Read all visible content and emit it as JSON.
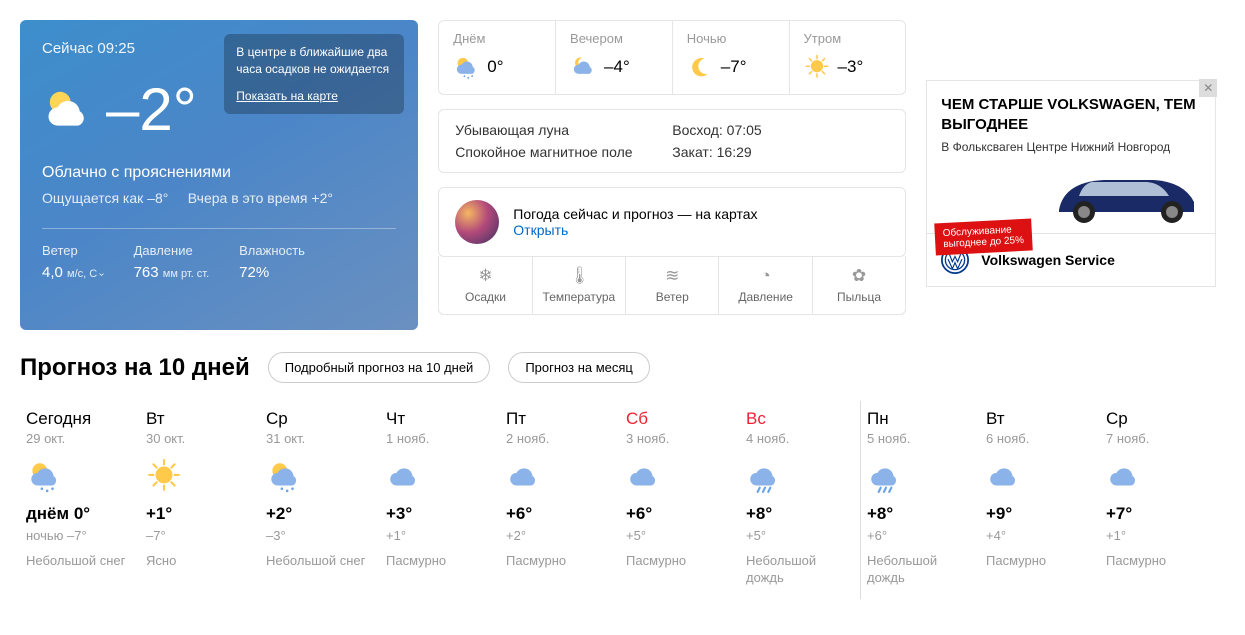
{
  "now": {
    "time_label": "Сейчас 09:25",
    "temp": "–2°",
    "condition": "Облачно с прояснениями",
    "feels_prefix": "Ощущается как ",
    "feels_temp": "–8°",
    "yesterday_prefix": "Вчера в это время ",
    "yesterday_temp": "+2°",
    "wind_label": "Ветер",
    "wind_value": "4,0",
    "wind_unit": "м/с, С",
    "pressure_label": "Давление",
    "pressure_value": "763",
    "pressure_unit": "мм рт. ст.",
    "humidity_label": "Влажность",
    "humidity_value": "72%",
    "bubble_text": "В центре в ближайшие два часа осадков не ожидается",
    "bubble_link": "Показать на карте"
  },
  "dayparts": [
    {
      "label": "Днём",
      "temp": "0°",
      "icon": "snow-cloud"
    },
    {
      "label": "Вечером",
      "temp": "–4°",
      "icon": "partly-cloudy-night"
    },
    {
      "label": "Ночью",
      "temp": "–7°",
      "icon": "moon"
    },
    {
      "label": "Утром",
      "temp": "–3°",
      "icon": "sunny"
    }
  ],
  "astro": {
    "moon": "Убывающая луна",
    "magnetic": "Спокойное магнитное поле",
    "sunrise": "Восход: 07:05",
    "sunset": "Закат: 16:29"
  },
  "maps": {
    "text": "Погода сейчас и прогноз — на картах",
    "link": "Открыть"
  },
  "map_tabs": [
    "Осадки",
    "Температура",
    "Ветер",
    "Давление",
    "Пыльца"
  ],
  "ad": {
    "headline": "ЧЕМ СТАРШЕ VOLKSWAGEN, ТЕМ ВЫГОДНЕЕ",
    "sub": "В Фольксваген Центре Нижний Новгород",
    "sticker1": "Обслуживание",
    "sticker2": "выгоднее до 25%",
    "footer": "Volkswagen Service"
  },
  "tenday": {
    "heading": "Прогноз на 10 дней",
    "pill1": "Подробный прогноз на 10 дней",
    "pill2": "Прогноз на месяц",
    "hi_prefix": "днём ",
    "lo_prefix": "ночью "
  },
  "days": [
    {
      "wk": "Сегодня",
      "date": "29 окт.",
      "hi": "0°",
      "lo": "–7°",
      "cond": "Небольшой снег",
      "icon": "snow-cloud",
      "red": false,
      "first": true,
      "next": false
    },
    {
      "wk": "Вт",
      "date": "30 окт.",
      "hi": "+1°",
      "lo": "–7°",
      "cond": "Ясно",
      "icon": "sunny",
      "red": false,
      "next": false
    },
    {
      "wk": "Ср",
      "date": "31 окт.",
      "hi": "+2°",
      "lo": "–3°",
      "cond": "Небольшой снег",
      "icon": "snow-cloud",
      "red": false,
      "next": false
    },
    {
      "wk": "Чт",
      "date": "1 нояб.",
      "hi": "+3°",
      "lo": "+1°",
      "cond": "Пасмурно",
      "icon": "cloudy",
      "red": false,
      "next": false
    },
    {
      "wk": "Пт",
      "date": "2 нояб.",
      "hi": "+6°",
      "lo": "+2°",
      "cond": "Пасмурно",
      "icon": "cloudy",
      "red": false,
      "next": false
    },
    {
      "wk": "Сб",
      "date": "3 нояб.",
      "hi": "+6°",
      "lo": "+5°",
      "cond": "Пасмурно",
      "icon": "cloudy",
      "red": true,
      "next": false
    },
    {
      "wk": "Вс",
      "date": "4 нояб.",
      "hi": "+8°",
      "lo": "+5°",
      "cond": "Небольшой дождь",
      "icon": "rain",
      "red": true,
      "next": false
    },
    {
      "wk": "Пн",
      "date": "5 нояб.",
      "hi": "+8°",
      "lo": "+6°",
      "cond": "Небольшой дождь",
      "icon": "rain",
      "red": false,
      "next": true
    },
    {
      "wk": "Вт",
      "date": "6 нояб.",
      "hi": "+9°",
      "lo": "+4°",
      "cond": "Пасмурно",
      "icon": "cloudy",
      "red": false,
      "next": false
    },
    {
      "wk": "Ср",
      "date": "7 нояб.",
      "hi": "+7°",
      "lo": "+1°",
      "cond": "Пасмурно",
      "icon": "cloudy",
      "red": false,
      "next": false
    }
  ]
}
